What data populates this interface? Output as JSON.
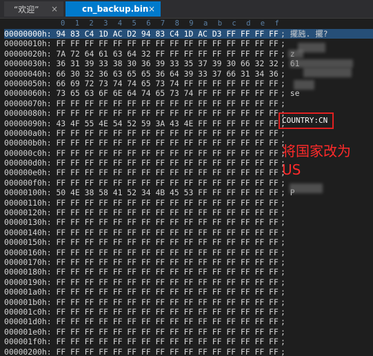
{
  "tabs": [
    {
      "label": "“欢迎”",
      "close": "×"
    },
    {
      "label": "cn_backup.bin",
      "close": "×"
    }
  ],
  "ruler": [
    "0",
    "1",
    "2",
    "3",
    "4",
    "5",
    "6",
    "7",
    "8",
    "9",
    "a",
    "b",
    "c",
    "d",
    "e",
    "f"
  ],
  "rows": [
    {
      "addr": "00000000h:",
      "hex": "94 83 C4 1D AC D2 94 83 C4 1D AC D3 FF FF FF FF",
      "ascii": "; 擺瓲. 擺?"
    },
    {
      "addr": "00000010h:",
      "hex": "FF FF FF FF FF FF FF FF FF FF FF FF FF FF FF FF",
      "ascii": ";"
    },
    {
      "addr": "00000020h:",
      "hex": "7A 72 64 61 63 64 32 FF FF FF FF FF FF FF FF FF",
      "ascii": "; z"
    },
    {
      "addr": "00000030h:",
      "hex": "36 31 39 33 38 30 36 39 33 35 37 39 30 66 32 32",
      "ascii": "; 61"
    },
    {
      "addr": "00000040h:",
      "hex": "66 30 32 36 63 65 65 36 64 39 33 37 66 31 34 36",
      "ascii": ";"
    },
    {
      "addr": "00000050h:",
      "hex": "66 69 72 73 74 74 65 73 74 FF FF FF FF FF FF FF",
      "ascii": ";"
    },
    {
      "addr": "00000060h:",
      "hex": "73 65 63 6F 6E 64 74 65 73 74 FF FF FF FF FF FF",
      "ascii": "; se"
    },
    {
      "addr": "00000070h:",
      "hex": "FF FF FF FF FF FF FF FF FF FF FF FF FF FF FF FF",
      "ascii": ";"
    },
    {
      "addr": "00000080h:",
      "hex": "FF FF FF FF FF FF FF FF FF FF FF FF FF FF FF FF",
      "ascii": ";"
    },
    {
      "addr": "00000090h:",
      "hex": "43 4F 55 4E 54 52 59 3A 43 4E FF FF FF FF FF FF",
      "ascii": ";"
    },
    {
      "addr": "000000a0h:",
      "hex": "FF FF FF FF FF FF FF FF FF FF FF FF FF FF FF FF",
      "ascii": ";"
    },
    {
      "addr": "000000b0h:",
      "hex": "FF FF FF FF FF FF FF FF FF FF FF FF FF FF FF FF",
      "ascii": ";"
    },
    {
      "addr": "000000c0h:",
      "hex": "FF FF FF FF FF FF FF FF FF FF FF FF FF FF FF FF",
      "ascii": ";"
    },
    {
      "addr": "000000d0h:",
      "hex": "FF FF FF FF FF FF FF FF FF FF FF FF FF FF FF FF",
      "ascii": ";"
    },
    {
      "addr": "000000e0h:",
      "hex": "FF FF FF FF FF FF FF FF FF FF FF FF FF FF FF FF",
      "ascii": ";"
    },
    {
      "addr": "000000f0h:",
      "hex": "FF FF FF FF FF FF FF FF FF FF FF FF FF FF FF FF",
      "ascii": ";"
    },
    {
      "addr": "00000100h:",
      "hex": "50 4E 38 58 41 52 34 4B 45 53 FF FF FF FF FF FF",
      "ascii": "; P"
    },
    {
      "addr": "00000110h:",
      "hex": "FF FF FF FF FF FF FF FF FF FF FF FF FF FF FF FF",
      "ascii": ";"
    },
    {
      "addr": "00000120h:",
      "hex": "FF FF FF FF FF FF FF FF FF FF FF FF FF FF FF FF",
      "ascii": ";"
    },
    {
      "addr": "00000130h:",
      "hex": "FF FF FF FF FF FF FF FF FF FF FF FF FF FF FF FF",
      "ascii": ";"
    },
    {
      "addr": "00000140h:",
      "hex": "FF FF FF FF FF FF FF FF FF FF FF FF FF FF FF FF",
      "ascii": ";"
    },
    {
      "addr": "00000150h:",
      "hex": "FF FF FF FF FF FF FF FF FF FF FF FF FF FF FF FF",
      "ascii": ";"
    },
    {
      "addr": "00000160h:",
      "hex": "FF FF FF FF FF FF FF FF FF FF FF FF FF FF FF FF",
      "ascii": ";"
    },
    {
      "addr": "00000170h:",
      "hex": "FF FF FF FF FF FF FF FF FF FF FF FF FF FF FF FF",
      "ascii": ";"
    },
    {
      "addr": "00000180h:",
      "hex": "FF FF FF FF FF FF FF FF FF FF FF FF FF FF FF FF",
      "ascii": ";"
    },
    {
      "addr": "00000190h:",
      "hex": "FF FF FF FF FF FF FF FF FF FF FF FF FF FF FF FF",
      "ascii": ";"
    },
    {
      "addr": "000001a0h:",
      "hex": "FF FF FF FF FF FF FF FF FF FF FF FF FF FF FF FF",
      "ascii": ";"
    },
    {
      "addr": "000001b0h:",
      "hex": "FF FF FF FF FF FF FF FF FF FF FF FF FF FF FF FF",
      "ascii": ";"
    },
    {
      "addr": "000001c0h:",
      "hex": "FF FF FF FF FF FF FF FF FF FF FF FF FF FF FF FF",
      "ascii": ";"
    },
    {
      "addr": "000001d0h:",
      "hex": "FF FF FF FF FF FF FF FF FF FF FF FF FF FF FF FF",
      "ascii": ";"
    },
    {
      "addr": "000001e0h:",
      "hex": "FF FF FF FF FF FF FF FF FF FF FF FF FF FF FF FF",
      "ascii": ";"
    },
    {
      "addr": "000001f0h:",
      "hex": "FF FF FF FF FF FF FF FF FF FF FF FF FF FF FF FF",
      "ascii": ";"
    },
    {
      "addr": "00000200h:",
      "hex": "FF FF FF FF FF FF FF FF FF FF FF FF FF FF FF FF",
      "ascii": ";"
    }
  ],
  "highlight": {
    "text": "COUNTRY:CN",
    "color": "#e02020"
  },
  "annotation": {
    "line1": "将国家改为",
    "line2": "US",
    "color": "#ff2a2a"
  },
  "colors": {
    "selection": "#264f78",
    "active_tab": "#007acc",
    "background": "#1e1e1e"
  }
}
